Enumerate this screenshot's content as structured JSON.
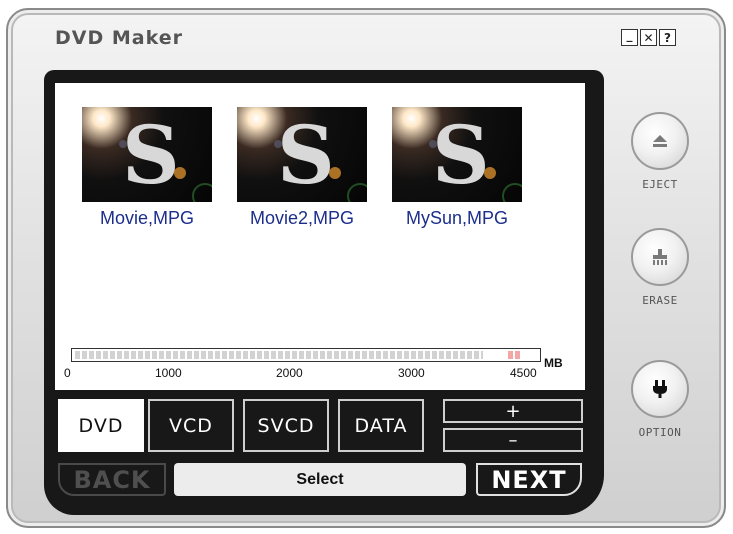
{
  "app": {
    "title": "DVD Maker"
  },
  "window_buttons": [
    {
      "name": "minimize",
      "glyph": "_"
    },
    {
      "name": "close",
      "glyph": "✕"
    },
    {
      "name": "help",
      "glyph": "?"
    }
  ],
  "files": [
    {
      "name": "Movie,MPG"
    },
    {
      "name": "Movie2,MPG"
    },
    {
      "name": "MySun,MPG"
    }
  ],
  "capacity": {
    "unit": "MB",
    "ticks": [
      "0",
      "1000",
      "2000",
      "3000",
      "4500"
    ],
    "max_mb": 4700,
    "used_fraction": 0.95,
    "limit_marker_mb": 4500
  },
  "disc_types": [
    {
      "label": "DVD",
      "active": true
    },
    {
      "label": "VCD",
      "active": false
    },
    {
      "label": "SVCD",
      "active": false
    },
    {
      "label": "DATA",
      "active": false
    }
  ],
  "size_controls": {
    "plus": "+",
    "minus": "–"
  },
  "nav": {
    "back_label": "BACK",
    "status": "Select",
    "next_label": "NEXT"
  },
  "side_buttons": [
    {
      "label": "EJECT",
      "icon": "eject-icon"
    },
    {
      "label": "ERASE",
      "icon": "erase-icon"
    },
    {
      "label": "OPTION",
      "icon": "plug-icon"
    }
  ],
  "colors": {
    "file_name": "#1c2e8c",
    "panel": "#181818",
    "capacity_warning": "#f3a6a6"
  }
}
